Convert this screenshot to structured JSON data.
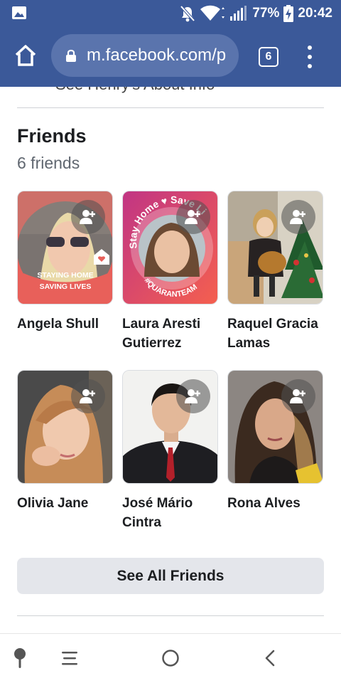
{
  "status_bar": {
    "battery": "77%",
    "time": "20:42"
  },
  "browser": {
    "url": "m.facebook.com/p",
    "tab_count": "6"
  },
  "above_fold": {
    "link_text": "See Henry's About Info"
  },
  "friends": {
    "title": "Friends",
    "count_label": "6 friends",
    "items": [
      {
        "name": "Angela Shull",
        "badge_line1": "STAYING HOME",
        "badge_line2": "SAVING LIVES"
      },
      {
        "name": "Laura Aresti Gutierrez",
        "badge_top": "Stay Home ♥ Save Li",
        "badge_bottom": "#QUARANTEAM"
      },
      {
        "name": "Raquel Gracia Lamas"
      },
      {
        "name": "Olivia Jane"
      },
      {
        "name": "José Mário Cintra"
      },
      {
        "name": "Rona Alves"
      }
    ],
    "see_all_label": "See All Friends"
  },
  "nav": {
    "icons": [
      "assistant-icon",
      "recents-icon",
      "home-circle-icon",
      "back-icon"
    ]
  },
  "colors": {
    "facebook_blue": "#3b5999",
    "url_bg": "#5a74ad",
    "button_gray": "#e4e6eb"
  }
}
